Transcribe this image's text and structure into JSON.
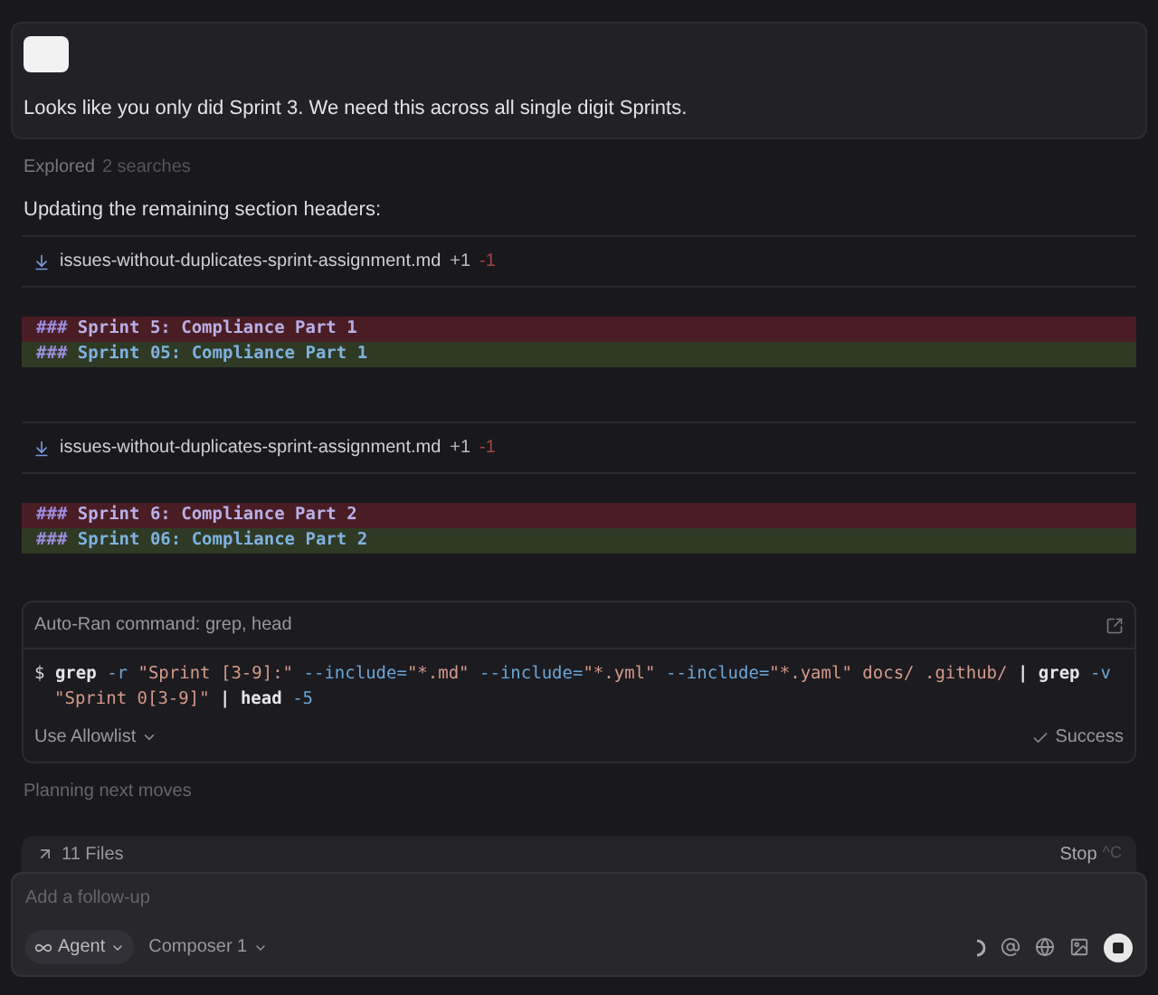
{
  "message": {
    "text": "Looks like you only did Sprint 3. We need this across all single digit Sprints."
  },
  "explored": {
    "label": "Explored",
    "detail": "2 searches"
  },
  "intro": "Updating the remaining section headers:",
  "edits": [
    {
      "file": "issues-without-duplicates-sprint-assignment.md",
      "added": "+1",
      "removed": "-1",
      "lines": [
        {
          "kind": "removed",
          "hash": "###",
          "text": "Sprint 5: Compliance Part 1"
        },
        {
          "kind": "added",
          "hash": "###",
          "text": "Sprint 05: Compliance Part 1"
        }
      ]
    },
    {
      "file": "issues-without-duplicates-sprint-assignment.md",
      "added": "+1",
      "removed": "-1",
      "lines": [
        {
          "kind": "removed",
          "hash": "###",
          "text": "Sprint 6: Compliance Part 2"
        },
        {
          "kind": "added",
          "hash": "###",
          "text": "Sprint 06: Compliance Part 2"
        }
      ]
    }
  ],
  "command": {
    "title": "Auto-Ran command: grep, head",
    "lines": [
      [
        {
          "kind": "plain",
          "text": "$ "
        },
        {
          "kind": "cmd",
          "text": "grep"
        },
        {
          "kind": "flag",
          "text": " -r "
        },
        {
          "kind": "str",
          "text": "\"Sprint [3-9]:\""
        },
        {
          "kind": "flag",
          "text": " --include="
        },
        {
          "kind": "str",
          "text": "\"*.md\""
        },
        {
          "kind": "flag",
          "text": " --include="
        },
        {
          "kind": "str",
          "text": "\"*.yml\""
        },
        {
          "kind": "flag",
          "text": " --include="
        },
        {
          "kind": "str",
          "text": "\"*.yaml\""
        },
        {
          "kind": "str",
          "text": " docs/ .github/ "
        },
        {
          "kind": "cmd",
          "text": "| grep"
        },
        {
          "kind": "flag",
          "text": " -v"
        }
      ],
      [
        {
          "kind": "str",
          "text": "\"Sprint 0[3-9]\""
        },
        {
          "kind": "cmd",
          "text": " | head"
        },
        {
          "kind": "flag",
          "text": " -5"
        }
      ]
    ],
    "allowlist": "Use Allowlist",
    "status": "Success"
  },
  "planning": "Planning next moves",
  "files_bar": {
    "label": "11 Files",
    "stop": "Stop",
    "shortcut": "^C"
  },
  "input": {
    "placeholder": "Add a follow-up",
    "mode": "Agent",
    "model": "Composer 1"
  }
}
